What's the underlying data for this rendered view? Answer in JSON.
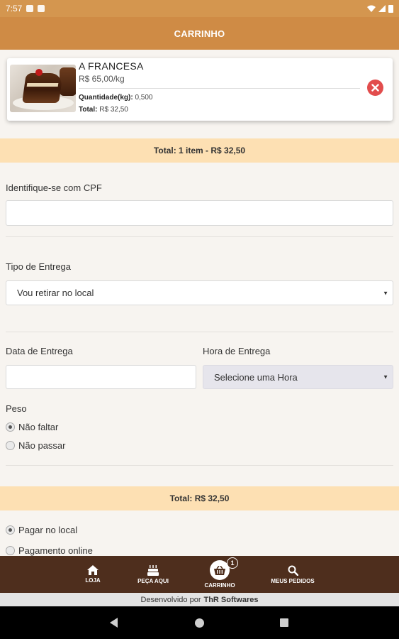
{
  "status_bar": {
    "time": "7:57"
  },
  "header": {
    "title": "CARRINHO"
  },
  "cart": {
    "items": [
      {
        "name": "A FRANCESA",
        "unit_price": "R$ 65,00/kg",
        "qty_label": "Quantidade(kg):",
        "qty_value": "0,500",
        "total_label": "Total:",
        "total_value": "R$ 32,50"
      }
    ],
    "summary": "Total: 1 item - R$ 32,50"
  },
  "form": {
    "cpf_label": "Identifique-se com CPF",
    "cpf_value": "",
    "delivery_type_label": "Tipo de Entrega",
    "delivery_type_value": "Vou retirar no local",
    "date_label": "Data de Entrega",
    "date_value": "",
    "time_label": "Hora de Entrega",
    "time_value": "Selecione uma Hora",
    "weight_label": "Peso",
    "weight_options": [
      {
        "label": "Não faltar",
        "selected": true
      },
      {
        "label": "Não passar",
        "selected": false
      }
    ]
  },
  "total_bar": "Total: R$ 32,50",
  "payment": {
    "options": [
      {
        "label": "Pagar no local",
        "selected": true
      },
      {
        "label": "Pagamento online",
        "selected": false
      }
    ]
  },
  "bottom_nav": {
    "items": [
      {
        "label": "LOJA",
        "icon": "home-icon"
      },
      {
        "label": "PEÇA AQUI",
        "icon": "cake-icon"
      },
      {
        "label": "CARRINHO",
        "icon": "basket-icon",
        "badge": "1"
      },
      {
        "label": "MEUS PEDIDOS",
        "icon": "search-icon"
      }
    ]
  },
  "footer": {
    "prefix": "Desenvolvido por",
    "brand": "ThR Softwares"
  },
  "colors": {
    "header": "#cf8b45",
    "status_bar": "#d4964f",
    "nav": "#4e2e1d",
    "summary": "#fde0b3",
    "remove": "#e24d4d"
  }
}
